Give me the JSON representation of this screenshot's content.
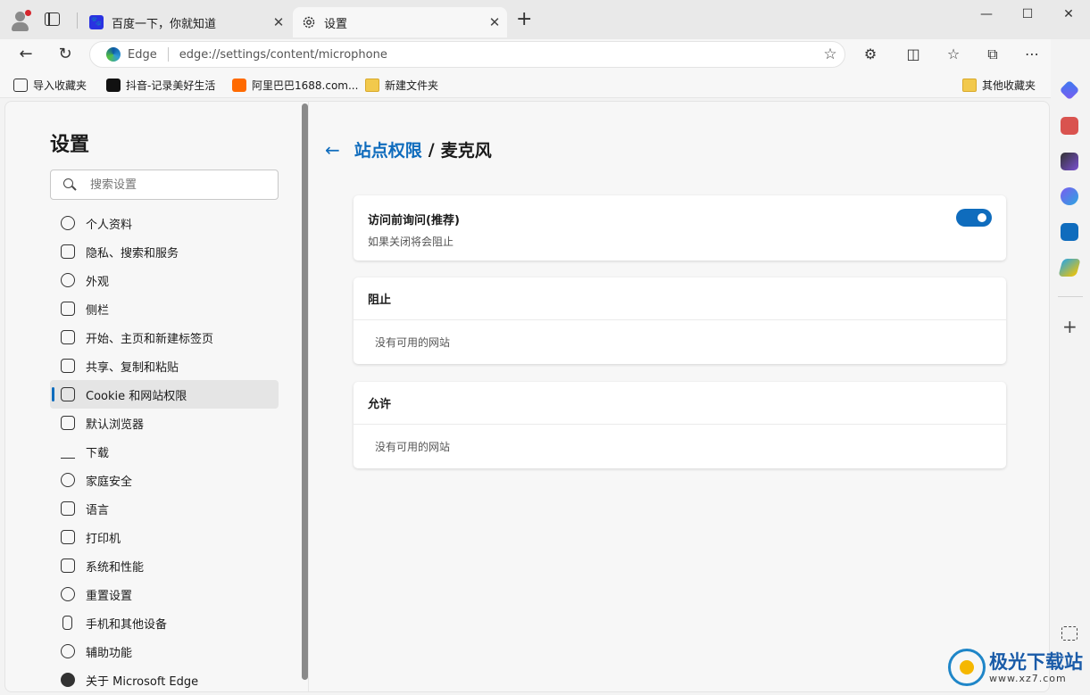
{
  "tabs": [
    {
      "title": "百度一下，你就知道",
      "icon": "baidu-icon"
    },
    {
      "title": "设置",
      "icon": "gear-icon",
      "active": true
    }
  ],
  "window_controls": {
    "minimize": "—",
    "maximize": "☐",
    "close": "✕"
  },
  "address_bar": {
    "brand": "Edge",
    "url": "edge://settings/content/microphone"
  },
  "bookmarks": [
    {
      "label": "导入收藏夹",
      "icon": "import-icon"
    },
    {
      "label": "抖音-记录美好生活",
      "icon": "tiktok-icon"
    },
    {
      "label": "阿里巴巴1688.com...",
      "icon": "alibaba-icon"
    },
    {
      "label": "新建文件夹",
      "icon": "folder-icon"
    },
    {
      "label": "其他收藏夹",
      "icon": "folder-icon"
    }
  ],
  "settings_nav": {
    "title": "设置",
    "search_placeholder": "搜索设置",
    "items": [
      {
        "label": "个人资料"
      },
      {
        "label": "隐私、搜索和服务"
      },
      {
        "label": "外观"
      },
      {
        "label": "侧栏"
      },
      {
        "label": "开始、主页和新建标签页"
      },
      {
        "label": "共享、复制和粘贴"
      },
      {
        "label": "Cookie 和网站权限",
        "active": true
      },
      {
        "label": "默认浏览器"
      },
      {
        "label": "下载"
      },
      {
        "label": "家庭安全"
      },
      {
        "label": "语言"
      },
      {
        "label": "打印机"
      },
      {
        "label": "系统和性能"
      },
      {
        "label": "重置设置"
      },
      {
        "label": "手机和其他设备"
      },
      {
        "label": "辅助功能"
      },
      {
        "label": "关于 Microsoft Edge"
      }
    ]
  },
  "page": {
    "breadcrumb_parent": "站点权限",
    "breadcrumb_separator": "/",
    "breadcrumb_current": "麦克风",
    "ask_before_access": {
      "label": "访问前询问(推荐)",
      "description": "如果关闭将会阻止",
      "enabled": true
    },
    "block": {
      "title": "阻止",
      "empty": "没有可用的网站"
    },
    "allow": {
      "title": "允许",
      "empty": "没有可用的网站"
    }
  },
  "watermark": {
    "title": "极光下载站",
    "url": "www.xz7.com"
  },
  "colors": {
    "accent": "#0f6cbd",
    "toggle_on": "#0f6cbd",
    "surface": "#f7f7f7"
  }
}
